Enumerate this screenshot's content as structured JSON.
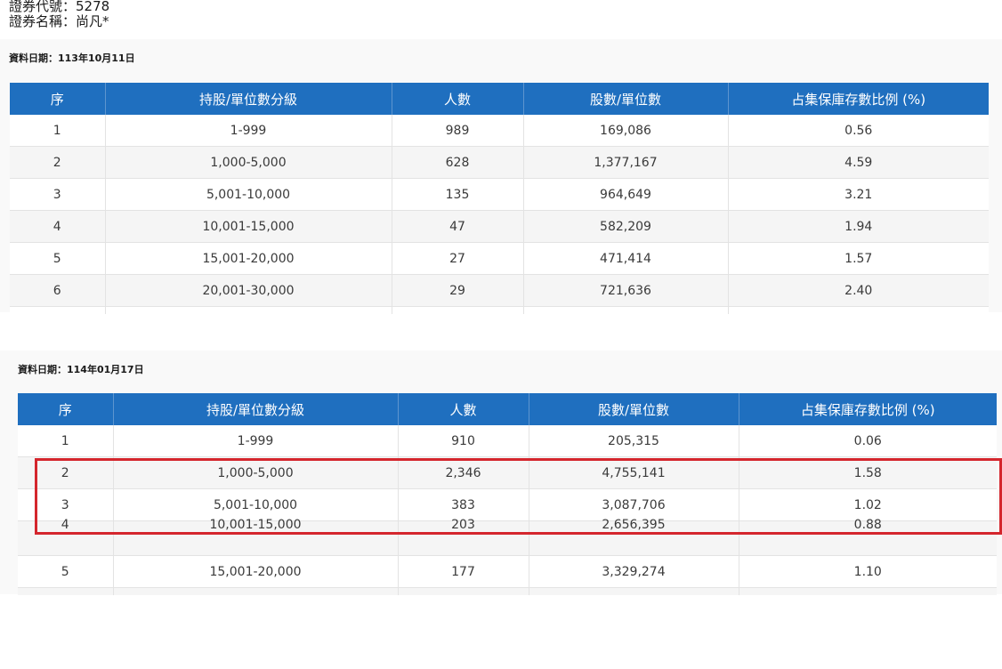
{
  "security": {
    "code_label": "證券代號：",
    "code": "5278",
    "name_label": "證券名稱：",
    "name": "尚凡*"
  },
  "columns": [
    "序",
    "持股/單位數分級",
    "人數",
    "股數/單位數",
    "占集保庫存數比例 (%)"
  ],
  "snapshots": [
    {
      "date_text": "資料日期：113年10月11日",
      "rows": [
        {
          "seq": "1",
          "level": "1-999",
          "holders": "989",
          "shares": "169,086",
          "pct": "0.56"
        },
        {
          "seq": "2",
          "level": "1,000-5,000",
          "holders": "628",
          "shares": "1,377,167",
          "pct": "4.59"
        },
        {
          "seq": "3",
          "level": "5,001-10,000",
          "holders": "135",
          "shares": "964,649",
          "pct": "3.21"
        },
        {
          "seq": "4",
          "level": "10,001-15,000",
          "holders": "47",
          "shares": "582,209",
          "pct": "1.94"
        },
        {
          "seq": "5",
          "level": "15,001-20,000",
          "holders": "27",
          "shares": "471,414",
          "pct": "1.57"
        },
        {
          "seq": "6",
          "level": "20,001-30,000",
          "holders": "29",
          "shares": "721,636",
          "pct": "2.40"
        }
      ]
    },
    {
      "date_text": "資料日期：114年01月17日",
      "rows": [
        {
          "seq": "1",
          "level": "1-999",
          "holders": "910",
          "shares": "205,315",
          "pct": "0.06"
        },
        {
          "seq": "2",
          "level": "1,000-5,000",
          "holders": "2,346",
          "shares": "4,755,141",
          "pct": "1.58"
        },
        {
          "seq": "3",
          "level": "5,001-10,000",
          "holders": "383",
          "shares": "3,087,706",
          "pct": "1.02"
        },
        {
          "seq": "4",
          "level": "10,001-15,000",
          "holders": "203",
          "shares": "2,656,395",
          "pct": "0.88"
        },
        {
          "seq": "5",
          "level": "15,001-20,000",
          "holders": "177",
          "shares": "3,329,274",
          "pct": "1.10"
        }
      ]
    }
  ],
  "highlight": {
    "color": "#d4262d"
  },
  "colors": {
    "header_bg": "#1f6fbf",
    "header_text": "#ffffff"
  }
}
